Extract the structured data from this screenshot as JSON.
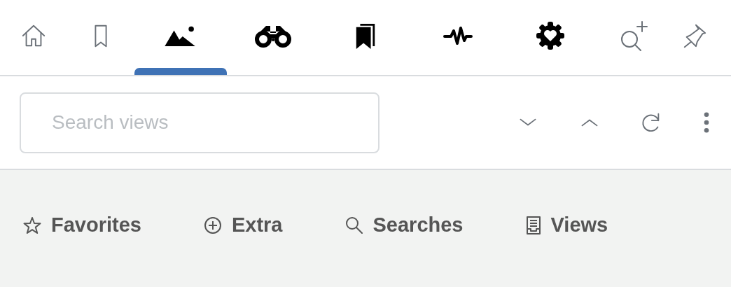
{
  "tabs": [
    {
      "kind": "home",
      "selected": false
    },
    {
      "kind": "bookmark",
      "selected": false
    },
    {
      "kind": "image",
      "selected": true
    },
    {
      "kind": "binoculars",
      "selected": false
    },
    {
      "kind": "bookmarks",
      "selected": false
    },
    {
      "kind": "activity",
      "selected": false
    },
    {
      "kind": "gear-heart",
      "selected": false
    },
    {
      "kind": "search-plus",
      "selected": false
    },
    {
      "kind": "pin",
      "selected": false
    }
  ],
  "search": {
    "placeholder": "Search views"
  },
  "actions": [
    {
      "kind": "down"
    },
    {
      "kind": "up"
    },
    {
      "kind": "refresh"
    },
    {
      "kind": "more"
    }
  ],
  "sections": [
    {
      "kind": "star",
      "label": "Favorites"
    },
    {
      "kind": "plus",
      "label": "Extra"
    },
    {
      "kind": "search",
      "label": "Searches"
    },
    {
      "kind": "views",
      "label": "Views"
    }
  ]
}
